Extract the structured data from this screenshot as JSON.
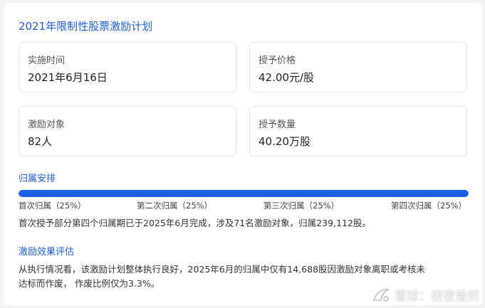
{
  "title": "2021年限制性股票激励计划",
  "cards": [
    {
      "label": "实施时间",
      "value": "2021年6月16日"
    },
    {
      "label": "授予价格",
      "value": "42.00元/股"
    },
    {
      "label": "激励对象",
      "value": "82人"
    },
    {
      "label": "授予数量",
      "value": "40.20万股"
    }
  ],
  "vesting": {
    "heading": "归属安排",
    "progress": 1.0,
    "bar_color": "#1c5ee8",
    "ticks": [
      "首次归属（25%）",
      "第二次归属（25%）",
      "第三次归属（25%）",
      "第四次归属（25%）"
    ],
    "note": "首次授予部分第四个归属期已于2025年6月完成，涉及71名激励对象，归属239,112股。"
  },
  "evaluation": {
    "heading": "激励效果评估",
    "line1": "从执行情况看，该激励计划整体执行良好，2025年6月的归属中仅有14,688股因激励对象离职或考核未",
    "line2": "达标而作废， 作废比例仅为3.3%。"
  },
  "watermark": {
    "icon": "snowball-icon",
    "text": "雪球：夜夜皆然"
  },
  "colors": {
    "accent": "#1f5fd6",
    "bar": "#1c5ee8",
    "border": "#e3e6eb"
  }
}
